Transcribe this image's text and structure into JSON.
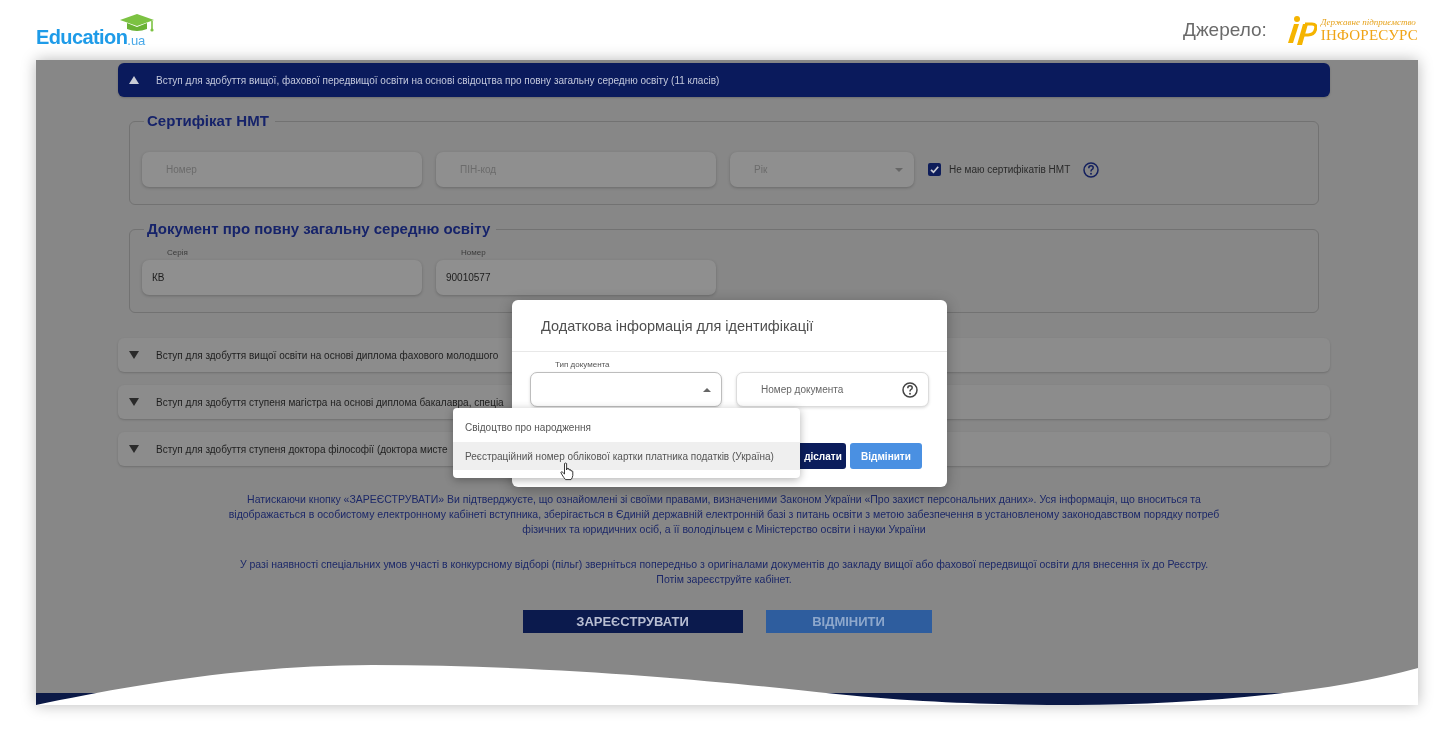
{
  "header": {
    "brand": {
      "name": "Education",
      "domain": ".ua"
    },
    "source": {
      "label": "Джерело:",
      "org_type": "Державне підприємство",
      "org_name": "ІНФОРЕСУРС"
    }
  },
  "sections": [
    {
      "title": "Вступ для здобуття вищої, фахової передвищої освіти на основі свідоцтва про повну загальну середню освіту (11 класів)",
      "expanded": true,
      "groups": [
        {
          "legend": "Сертифікат НМТ",
          "fields": [
            {
              "kind": "text",
              "placeholder": "Номер"
            },
            {
              "kind": "text",
              "placeholder": "ПІН-код"
            },
            {
              "kind": "select",
              "placeholder": "Рік",
              "expanded": false
            },
            {
              "kind": "checkbox",
              "label": "Не маю сертифікатів НМТ",
              "checked": true,
              "help": true
            }
          ]
        },
        {
          "legend": "Документ про повну загальну середню освіту",
          "fields": [
            {
              "kind": "text",
              "label": "Серія",
              "value": "КВ"
            },
            {
              "kind": "text",
              "label": "Номер",
              "value": "90010577"
            }
          ]
        }
      ]
    },
    {
      "title": "Вступ для здобуття вищої освіти на основі диплома фахового молодшого",
      "expanded": false
    },
    {
      "title": "Вступ для здобуття ступеня магістра на основі диплома бакалавра, спеціа",
      "expanded": false
    },
    {
      "title": "Вступ для здобуття ступеня доктора філософії (доктора мисте",
      "expanded": false
    }
  ],
  "notices": [
    "Натискаючи кнопку «ЗАРЕЄСТРУВАТИ» Ви підтверджуєте, що ознайомлені зі своїми правами, визначеними Законом України «Про захист персональних даних». Уся інформація, що вноситься та відображається в особистому електронному кабінеті вступника, зберігається в Єдиній державній електронній базі з питань освіти з метою забезпечення в установленому законодавством порядку потреб фізичних та юридичних осіб, а її володільцем є Міністерство освіти і науки України",
    "У разі наявності спеціальних умов участі в конкурсному відборі (пільг) зверніться попередньо з оригіналами документів до закладу вищої або фахової передвищої освіти для внесення їх до Реєстру. Потім зареєструйте кабінет."
  ],
  "actions": [
    {
      "label": "ЗАРЕЄСТРУВАТИ",
      "kind": "primary"
    },
    {
      "label": "ВІДМІНИТИ",
      "kind": "secondary"
    }
  ],
  "dialog": {
    "title": "Додаткова інформація для ідентифікації",
    "fields": [
      {
        "kind": "select",
        "label": "Тип документа",
        "expanded": true,
        "options": [
          {
            "label": "Свідоцтво про народження",
            "selected": false,
            "highlighted": false
          },
          {
            "label": "Реєстраційний номер облікової картки платника податків (Україна)",
            "selected": false,
            "highlighted": true
          }
        ]
      },
      {
        "kind": "text",
        "placeholder": "Номер документа",
        "help": true
      }
    ],
    "buttons": [
      {
        "label": "діслати",
        "kind": "primary"
      },
      {
        "label": "Відмінити",
        "kind": "secondary"
      }
    ]
  }
}
